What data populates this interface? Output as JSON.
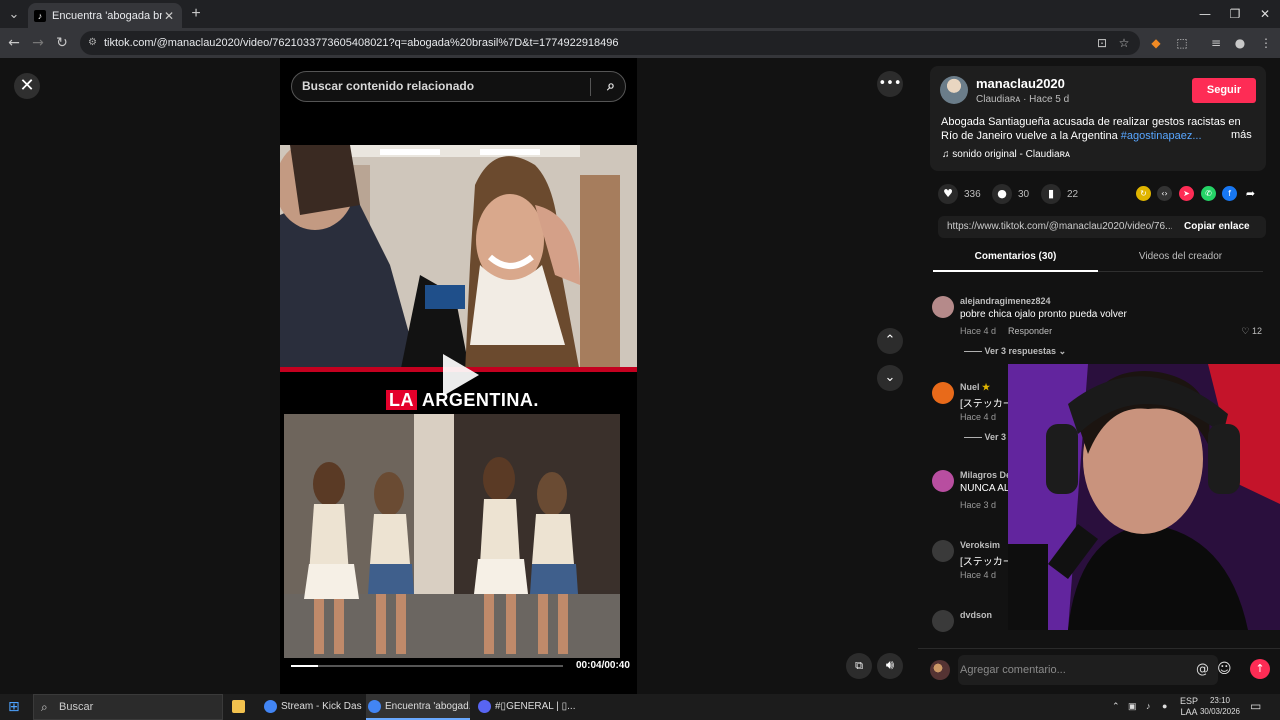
{
  "browser": {
    "tab_title": "Encuentra 'abogada brasil)' en",
    "url": "tiktok.com/@manaclau2020/video/7621033773605408021?q=abogada%20brasil%7D&t=1774922918496"
  },
  "search": {
    "placeholder": "Buscar contenido relacionado"
  },
  "video": {
    "logo_la": "LA",
    "logo_rest": " ARGENTINA.",
    "time": "00:04/00:40",
    "progress": 0.1
  },
  "author": {
    "username": "manaclau2020",
    "subline": "Claudiaʀᴀ · Hace 5 d",
    "follow_label": "Seguir",
    "description": "Abogada Santiagueña acusada de realizar gestos racistas en Río de Janeiro vuelve a la Argentina ",
    "hashtag": "#agostinapaez...",
    "more_label": "más",
    "music": "sonido original - Claudiaʀᴀ"
  },
  "stats": {
    "likes": "336",
    "comments": "30",
    "saves": "22"
  },
  "link": {
    "url": "https://www.tiktok.com/@manaclau2020/video/76...",
    "copy_label": "Copiar enlace"
  },
  "tabs": {
    "comments": "Comentarios (30)",
    "videos": "Videos del creador"
  },
  "comments": [
    {
      "name": "alejandragimenez824",
      "text": "pobre chica ojalo pronto pueda volver",
      "time": "Hace 4 d",
      "reply": "Responder",
      "likes": "12",
      "more": "Ver 3 respuestas"
    },
    {
      "name": "Nuel",
      "text": "[ステッカー",
      "time": "Hace 4 d",
      "reply": "R",
      "likes": "",
      "more": "Ver 3"
    },
    {
      "name": "Milagros De",
      "text": "NUNCA AL",
      "time": "Hace 3 d",
      "reply": "",
      "likes": "",
      "more": ""
    },
    {
      "name": "Veroksim",
      "text": "[ステッカー",
      "time": "Hace 4 d",
      "reply": "R",
      "likes": "",
      "more": ""
    },
    {
      "name": "dvdson",
      "text": "",
      "time": "",
      "reply": "",
      "likes": "",
      "more": ""
    }
  ],
  "comment_bar": {
    "placeholder": "Agregar comentario..."
  },
  "taskbar": {
    "search": "Buscar",
    "items": [
      "Stream - Kick Dash...",
      "Encuentra 'abogad...",
      "#▯GENERAL | ▯..."
    ],
    "lang_top": "ESP",
    "lang_bottom": "LAA",
    "time": "23:10",
    "date": "30/03/2026"
  },
  "colors": {
    "accent": "#fe2c55",
    "hashtag": "#58a6ff"
  }
}
